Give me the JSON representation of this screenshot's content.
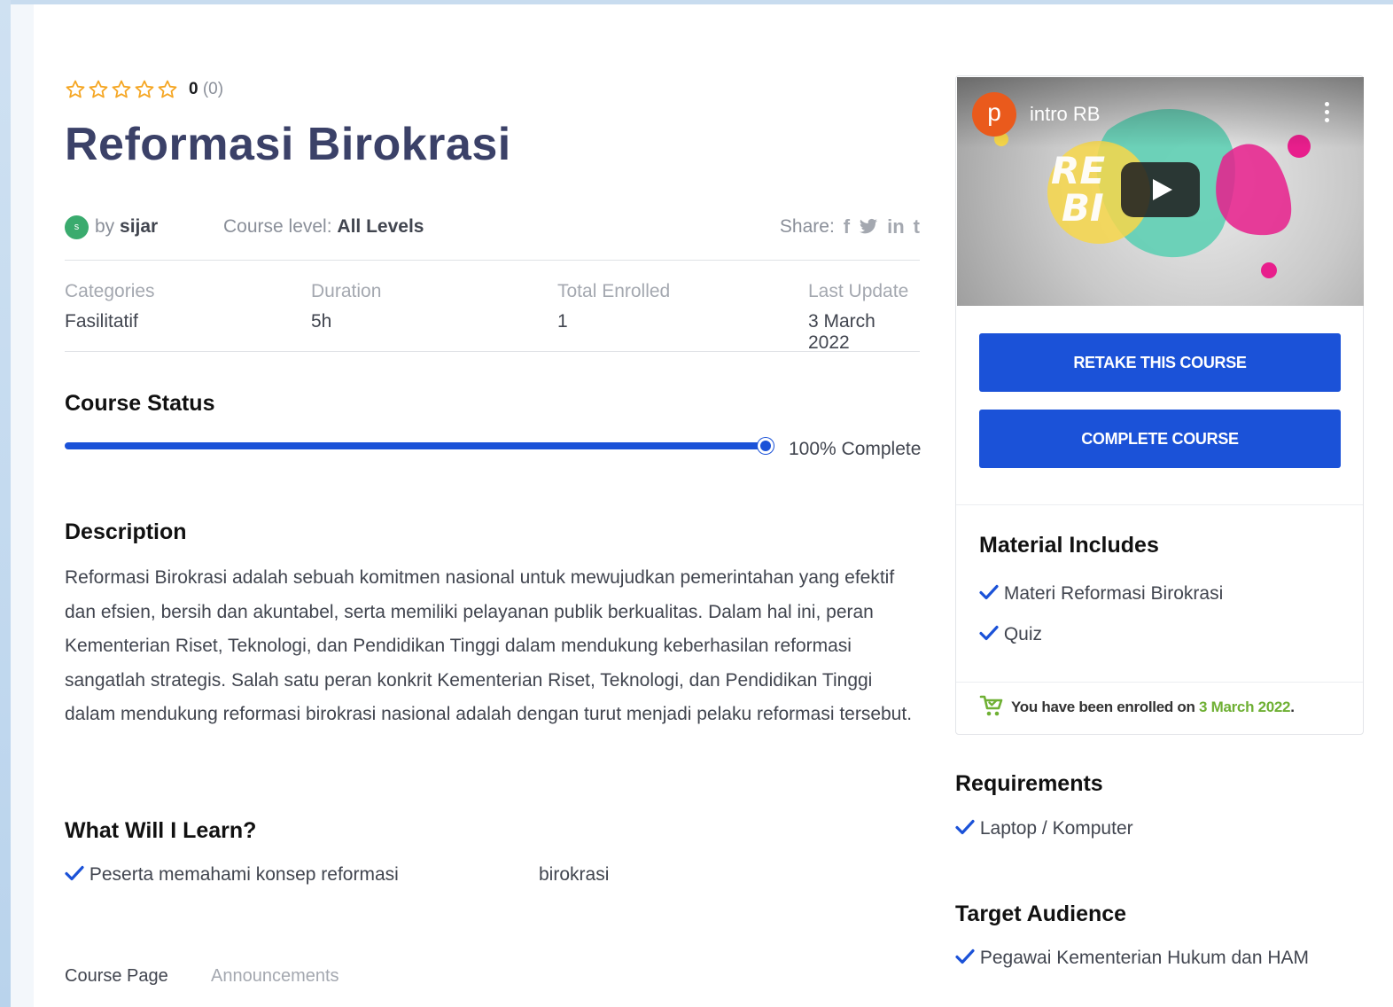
{
  "rating": {
    "value": "0",
    "count": "(0)"
  },
  "course": {
    "title": "Reformasi Birokrasi",
    "author_initial": "s",
    "by_label": "by",
    "author": "sijar",
    "level_label": "Course level:",
    "level": "All Levels",
    "share_label": "Share:"
  },
  "info": [
    {
      "label": "Categories",
      "value": "Fasilitatif"
    },
    {
      "label": "Duration",
      "value": "5h"
    },
    {
      "label": "Total Enrolled",
      "value": "1"
    },
    {
      "label": "Last Update",
      "value": "3 March 2022"
    }
  ],
  "status": {
    "heading": "Course Status",
    "progress": 1.0,
    "progress_text": "100% Complete"
  },
  "description": {
    "heading": "Description",
    "text": "Reformasi Birokrasi adalah sebuah komitmen nasional untuk mewujudkan pemerintahan yang efektif dan efsien, bersih dan akuntabel, serta memiliki pelayanan publik berkualitas. Dalam hal ini, peran Kementerian Riset, Teknologi, dan Pendidikan Tinggi dalam mendukung keberhasilan reformasi sangatlah strategis. Salah satu peran konkrit Kementerian Riset, Teknologi, dan Pendidikan Tinggi dalam mendukung reformasi birokrasi nasional adalah dengan turut menjadi pelaku reformasi tersebut."
  },
  "learn": {
    "heading": "What Will I Learn?",
    "item_part1": "Peserta memahami konsep reformasi",
    "item_part2": "birokrasi"
  },
  "tabs": {
    "course_page": "Course Page",
    "announcements": "Announcements"
  },
  "video": {
    "channel_initial": "p",
    "title": "intro RB"
  },
  "buttons": {
    "retake": "RETAKE THIS COURSE",
    "complete": "COMPLETE COURSE"
  },
  "materials": {
    "heading": "Material Includes",
    "items": [
      "Materi Reformasi Birokrasi",
      "Quiz"
    ]
  },
  "enrollment": {
    "text": "You have been enrolled on",
    "date": "3 March 2022",
    "suffix": "."
  },
  "requirements": {
    "heading": "Requirements",
    "items": [
      "Laptop / Komputer"
    ]
  },
  "audience": {
    "heading": "Target Audience",
    "items": [
      "Pegawai Kementerian Hukum dan HAM"
    ]
  },
  "colors": {
    "primary": "#1b52d8",
    "title": "#3b4168",
    "star": "#f5a623",
    "success": "#6fb034"
  }
}
